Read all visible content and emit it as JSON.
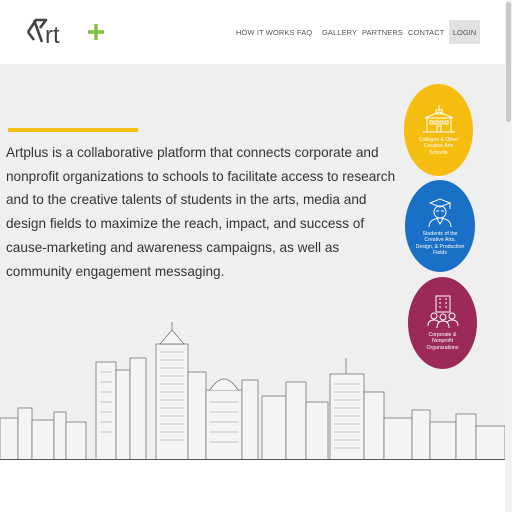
{
  "header": {
    "logo_text": "Art+",
    "nav": [
      "HOW IT WORKS",
      "FAQ",
      "GALLERY",
      "PARTNERS",
      "CONTACT"
    ],
    "login": "LOGIN"
  },
  "hero": {
    "intro": "Artplus is a collaborative platform that connects corporate and nonprofit organizations to schools to facilitate access to research and to the creative talents of students in the arts, media and design fields to maximize the reach, impact, and success of cause-marketing and awareness campaigns, as well as community engagement messaging."
  },
  "circles": [
    {
      "label": "Colleges & Other Creative Arts Schools",
      "color": "#f5bd10",
      "icon": "school-building-icon"
    },
    {
      "label": "Students of the Creative Arts, Design, & Production Fields",
      "color": "#1a6fc6",
      "icon": "graduate-student-icon"
    },
    {
      "label": "Corporate & Nonprofit Organizations",
      "color": "#9b2a5a",
      "icon": "organization-people-icon"
    }
  ],
  "colors": {
    "accent": "#f2c012",
    "logo_plus": "#7cc242",
    "text": "#333333"
  }
}
